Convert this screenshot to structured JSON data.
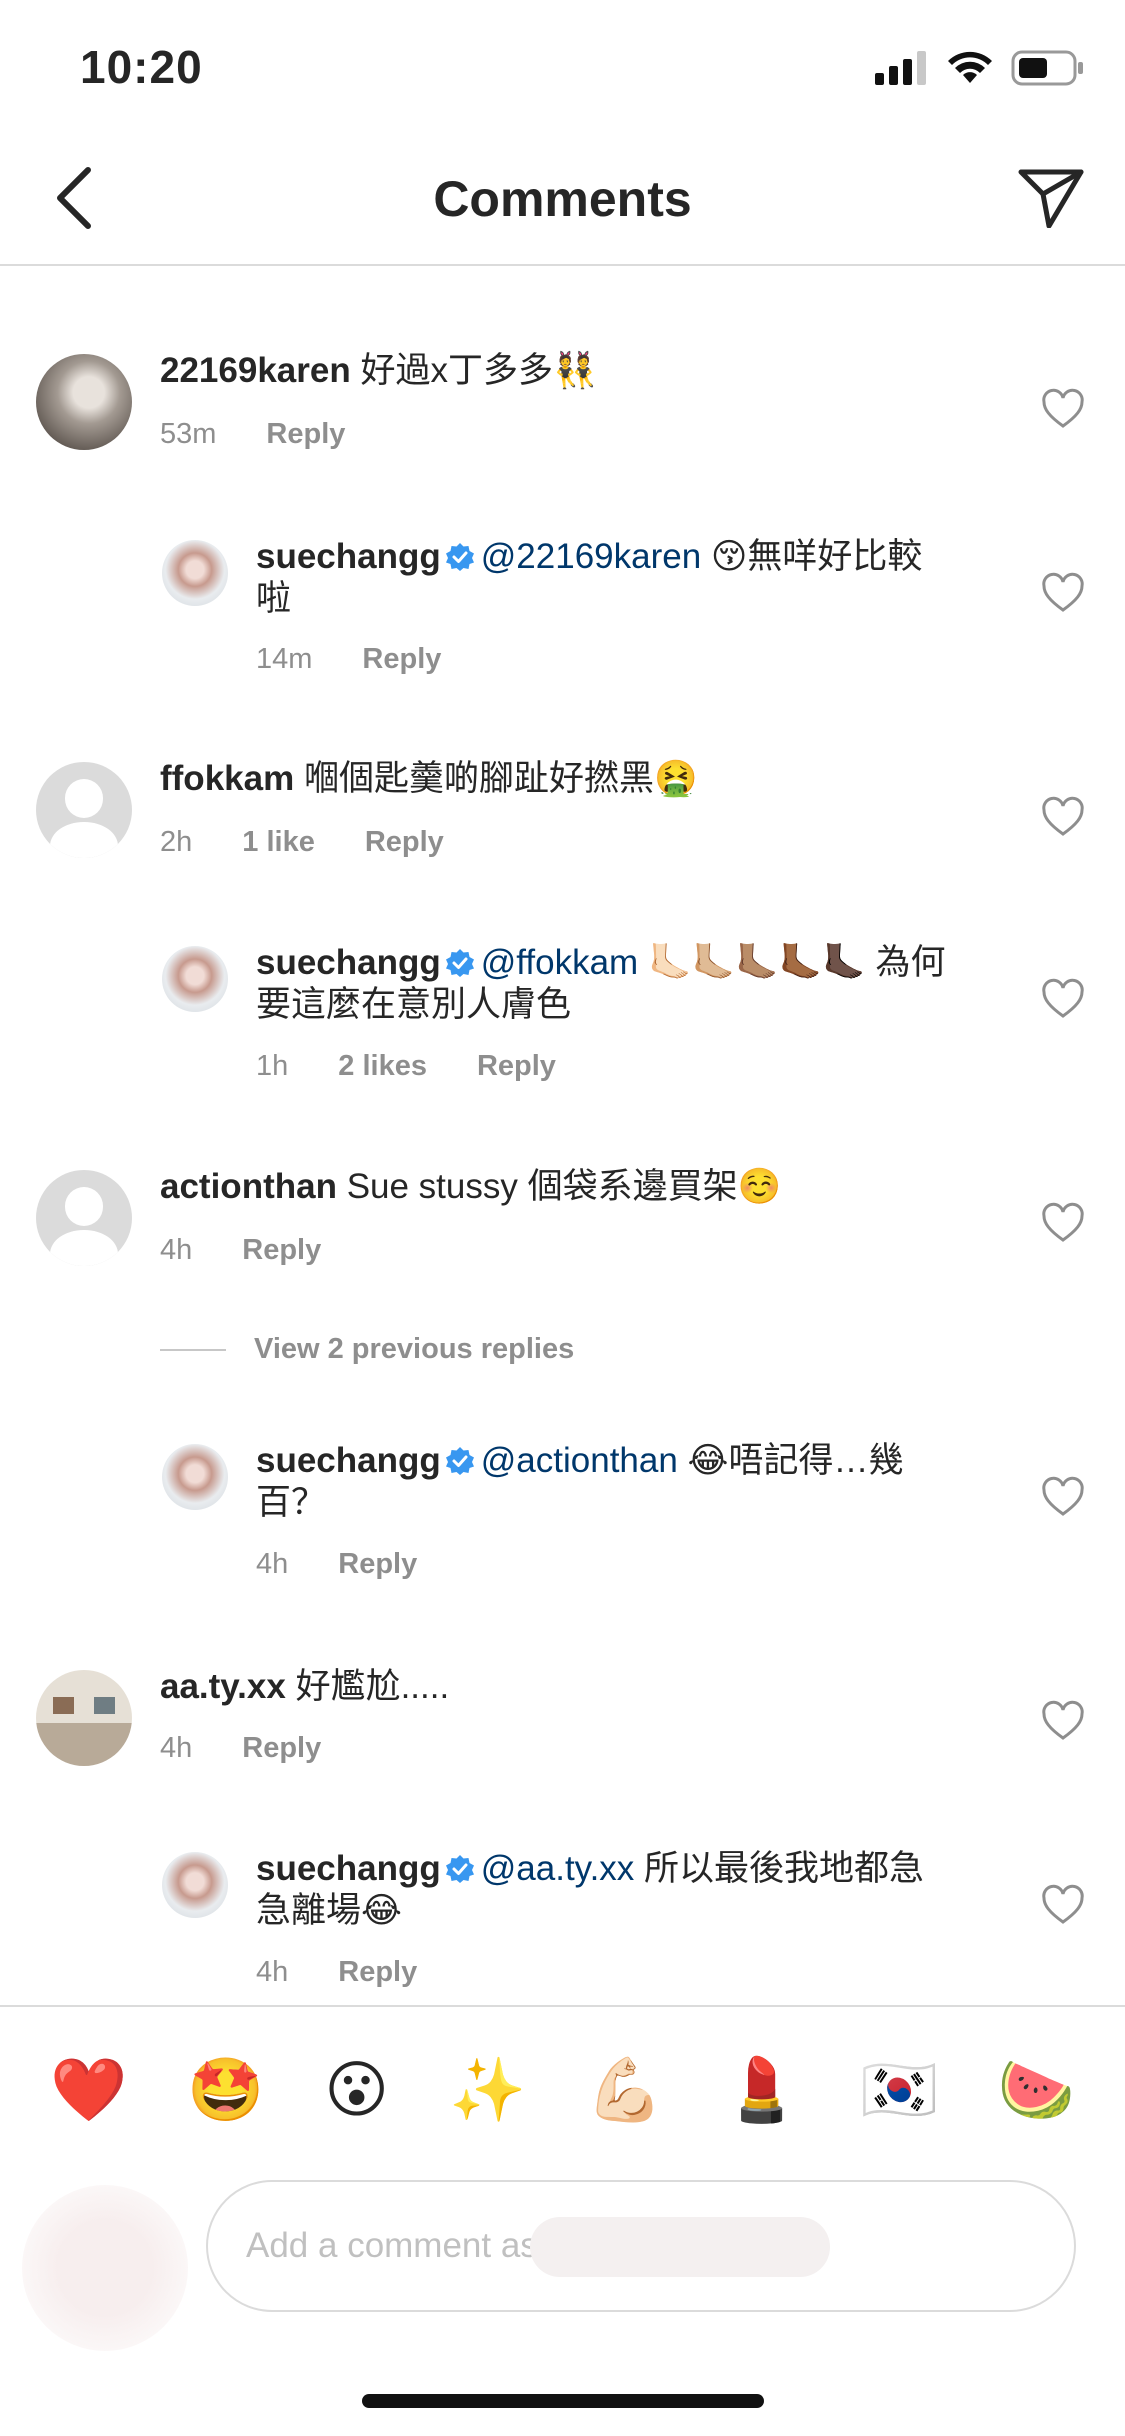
{
  "status_bar": {
    "time": "10:20"
  },
  "nav": {
    "title": "Comments"
  },
  "comments": [
    {
      "username": "22169karen",
      "text": "好過x丁多多👯",
      "time": "53m",
      "reply_label": "Reply"
    },
    {
      "username": "suechangg",
      "mention": "@22169karen",
      "text": "😚無咩好比較啦",
      "time": "14m",
      "reply_label": "Reply"
    },
    {
      "username": "ffokkam",
      "text": "嗰個匙羹啲腳趾好撚黑🤮",
      "time": "2h",
      "likes": "1 like",
      "reply_label": "Reply"
    },
    {
      "username": "suechangg",
      "mention": "@ffokkam",
      "text": "🦶🏻🦶🏼🦶🏽🦶🏾🦶🏿 為何要這麼在意別人膚色",
      "time": "1h",
      "likes": "2 likes",
      "reply_label": "Reply"
    },
    {
      "username": "actionthan",
      "text": "Sue stussy 個袋系邊買架☺️",
      "time": "4h",
      "reply_label": "Reply"
    },
    {
      "username": "suechangg",
      "mention": "@actionthan",
      "text": "😂唔記得…幾百？",
      "time": "4h",
      "reply_label": "Reply"
    },
    {
      "username": "aa.ty.xx",
      "text": "好尷尬.....",
      "time": "4h",
      "reply_label": "Reply"
    },
    {
      "username": "suechangg",
      "mention": "@aa.ty.xx",
      "text": "所以最後我地都急急離場😂",
      "time": "4h",
      "reply_label": "Reply"
    }
  ],
  "view_replies": "View 2 previous replies",
  "emoji_bar": [
    "❤️",
    "🤩",
    "😮",
    "✨",
    "💪🏻",
    "💄",
    "🇰🇷",
    "🍉"
  ],
  "comment_input": {
    "placeholder": "Add a comment as"
  },
  "colors": {
    "text": "#262626",
    "secondary": "#8e8e8e",
    "mention": "#00376b",
    "verified": "#3897f0",
    "divider": "#dbdbdb"
  }
}
